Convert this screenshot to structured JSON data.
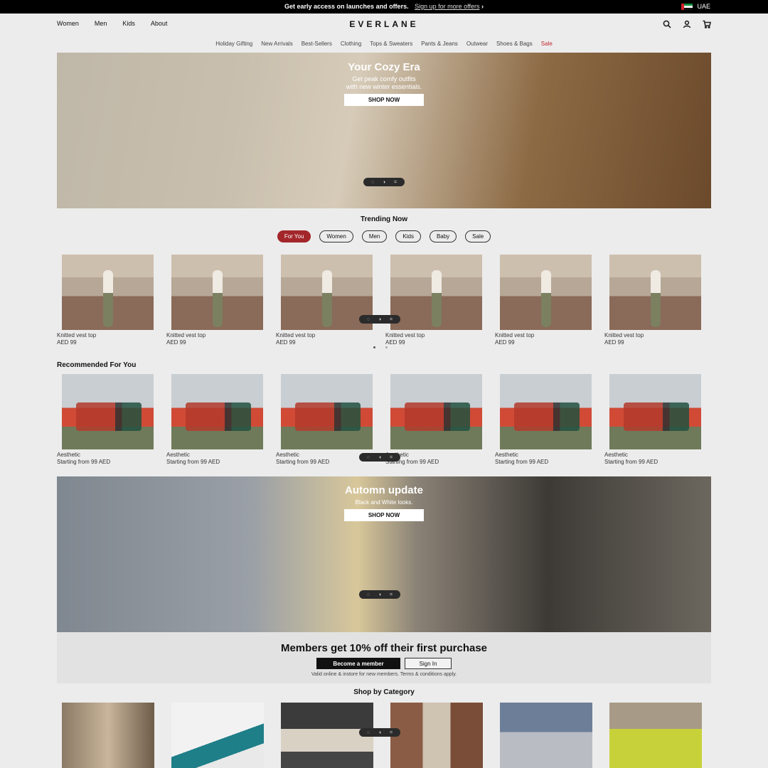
{
  "announcement": {
    "message": "Get early access on launches and offers.",
    "link": "Sign up for more offers",
    "arrow": "›",
    "region": "UAE"
  },
  "header": {
    "nav": [
      "Women",
      "Men",
      "Kids",
      "About"
    ],
    "logo": "EVERLANE",
    "icons": [
      "search-icon",
      "account-icon",
      "cart-icon"
    ]
  },
  "categories": [
    "Holiday Gifting",
    "New Arrivals",
    "Best-Sellers",
    "Clothing",
    "Tops & Sweaters",
    "Pants & Jeans",
    "Outwear",
    "Shoes & Bags",
    "Sale"
  ],
  "hero1": {
    "title": "Your Cozy Era",
    "subtitle_line1": "Get peak comfy outfits",
    "subtitle_line2": "with new winter essentials.",
    "button": "SHOP NOW"
  },
  "trending": {
    "title": "Trending Now",
    "chips": [
      "For You",
      "Women",
      "Men",
      "Kids",
      "Baby",
      "Sale"
    ],
    "active_chip": "For You",
    "items": [
      {
        "name": "Knitted vest top",
        "price": "AED 99"
      },
      {
        "name": "Knitted vest top",
        "price": "AED 99"
      },
      {
        "name": "Knitted vest top",
        "price": "AED 99"
      },
      {
        "name": "Knitted vest top",
        "price": "AED 99"
      },
      {
        "name": "Knitted vest top",
        "price": "AED 99"
      },
      {
        "name": "Knitted vest top",
        "price": "AED 99"
      }
    ]
  },
  "recommended": {
    "title": "Recommended For You",
    "items": [
      {
        "name": "Aesthetic",
        "price": "Starting from 99 AED"
      },
      {
        "name": "Aesthetic",
        "price": "Starting from 99 AED"
      },
      {
        "name": "Aesthetic",
        "price": "Starting from 99 AED"
      },
      {
        "name": "Aesthetic",
        "price": "Starting from 99 AED"
      },
      {
        "name": "Aesthetic",
        "price": "Starting from 99 AED"
      },
      {
        "name": "Aesthetic",
        "price": "Starting from 99 AED"
      }
    ]
  },
  "hero2": {
    "title": "Automn update",
    "subtitle": "Black and White looks.",
    "button": "SHOP NOW"
  },
  "members": {
    "headline": "Members get 10% off their first purchase",
    "primary_button": "Become a member",
    "secondary_button": "Sign In",
    "fine_print": "Valid online & instore for new members. Terms & conditions apply."
  },
  "shop_by_category": {
    "title": "Shop by Category"
  },
  "pager_glyphs": [
    "◌",
    "◑",
    "="
  ],
  "colors": {
    "accent": "#a3262a",
    "sale": "#c1272d",
    "announcement_bg": "#000000"
  }
}
